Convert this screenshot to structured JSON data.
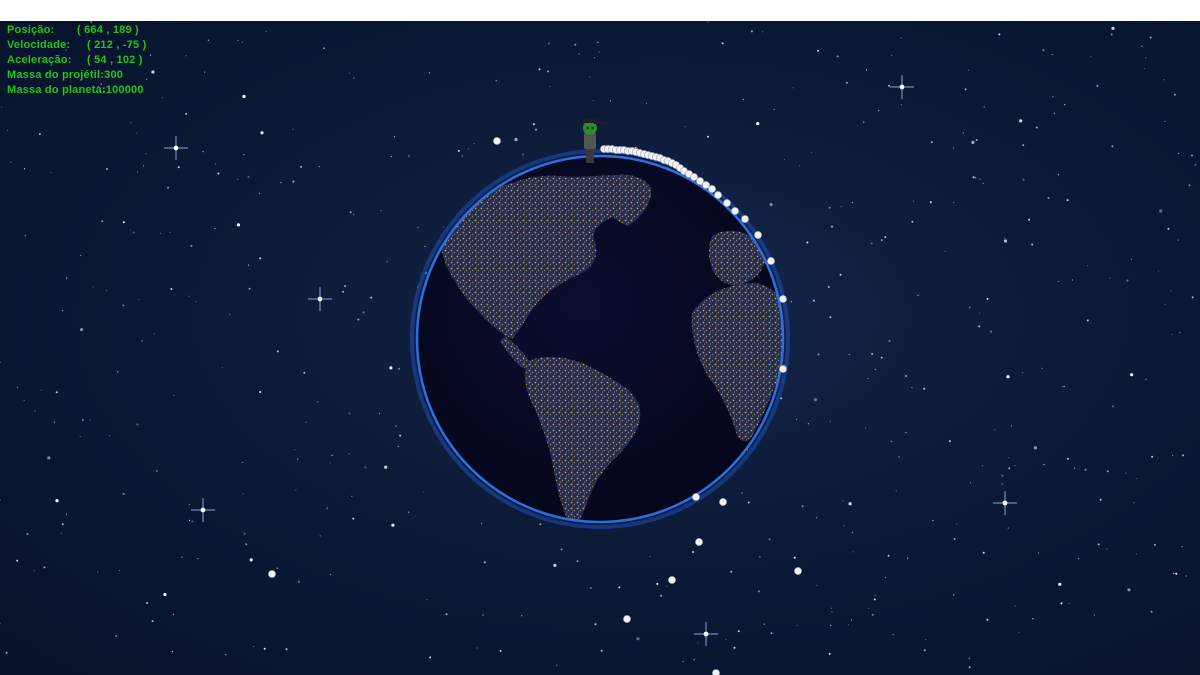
{
  "hud": {
    "position_label": "Posição:",
    "position_value": "( 664 , 189 )",
    "velocity_label": "Velocidade:",
    "velocity_value": "( 212 , -75 )",
    "acceleration_label": "Aceleração:",
    "acceleration_value": "( 54 , 102 )",
    "projectile_mass_label": "Massa do projétil:",
    "projectile_mass_value": "300",
    "planet_mass_label": "Massa do planeta:",
    "planet_mass_value": "100000",
    "text_color": "#22c41a"
  },
  "scene": {
    "background_color": "#0b1a36",
    "planet_rim_color": "#2d6fe0",
    "ocean_color": "#070a22",
    "land_light_color": "#c89a3a",
    "land_dark_color": "#1b2e63",
    "projectile_color": "#f2f2f2",
    "player_icon": "person-icon",
    "player_hat_color": "#2d8a2d"
  }
}
